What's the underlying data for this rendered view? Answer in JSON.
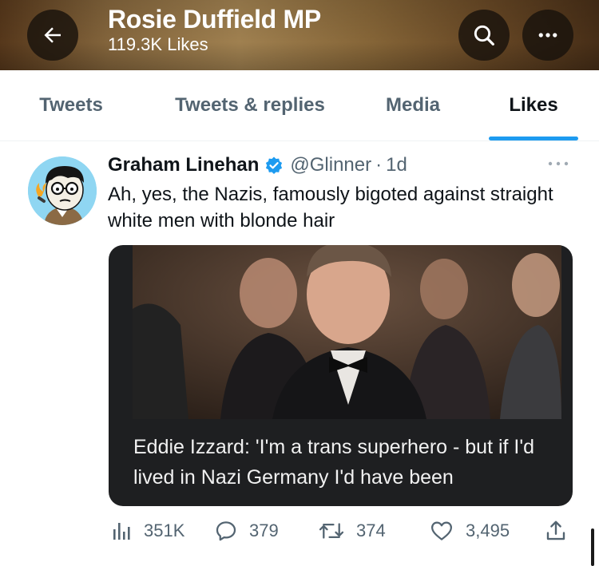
{
  "header": {
    "name": "Rosie Duffield MP",
    "likes_count": "119.3K Likes"
  },
  "tabs": [
    {
      "label": "Tweets",
      "active": false
    },
    {
      "label": "Tweets & replies",
      "active": false
    },
    {
      "label": "Media",
      "active": false
    },
    {
      "label": "Likes",
      "active": true
    }
  ],
  "tweet": {
    "author": "Graham Linehan",
    "handle": "@Glinner",
    "separator": "·",
    "time": "1d",
    "text": "Ah, yes, the Nazis, famously bigoted against straight white men with blonde hair",
    "media": {
      "caption": "Eddie Izzard: 'I'm a trans superhero - but if I'd lived in Nazi Germany I'd have been"
    },
    "actions": {
      "views": "351K",
      "replies": "379",
      "retweets": "374",
      "likes": "3,495"
    }
  },
  "colors": {
    "accent": "#1d9bf0",
    "muted": "#536471",
    "text": "#0f1419"
  },
  "icons": {
    "back": "arrow-left-icon",
    "search": "search-icon",
    "more": "more-horizontal-icon",
    "verified": "verified-badge-icon",
    "views": "analytics-icon",
    "reply": "reply-icon",
    "retweet": "retweet-icon",
    "like": "heart-icon",
    "share": "share-icon"
  }
}
